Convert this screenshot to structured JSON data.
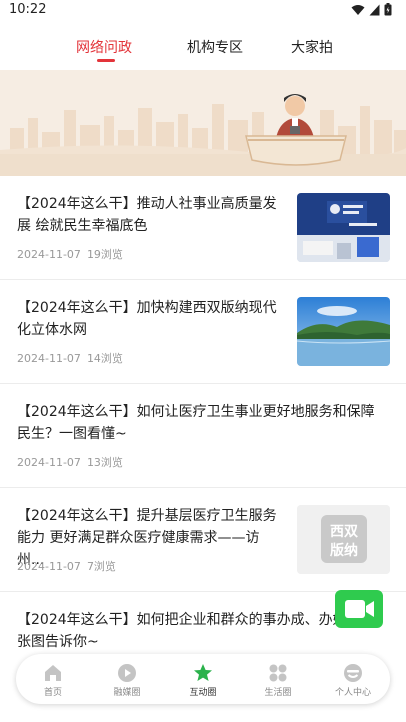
{
  "status_bar": {
    "time": "10:22"
  },
  "tabs": [
    {
      "label": "网络问政",
      "active": true
    },
    {
      "label": "机构专区",
      "active": false
    },
    {
      "label": "大家拍",
      "active": false
    }
  ],
  "articles": [
    {
      "title": "【2024年这么干】推动人社事业高质量发展 绘就民生幸福底色",
      "date": "2024-11-07",
      "views": "19浏览",
      "thumb": "hall-photo"
    },
    {
      "title": "【2024年这么干】加快构建西双版纳现代化立体水网",
      "date": "2024-11-07",
      "views": "14浏览",
      "thumb": "lake-photo"
    },
    {
      "title": "【2024年这么干】如何让医疗卫生事业更好地服务和保障民生？一图看懂~",
      "date": "2024-11-07",
      "views": "13浏览",
      "thumb": ""
    },
    {
      "title": "【2024年这么干】提升基层医疗卫生服务能力 更好满足群众医疗健康需求——访州...",
      "date": "2024-11-07",
      "views": "7浏览",
      "thumb": "xsbn-logo",
      "logo_text": [
        "西双",
        "版纳"
      ]
    },
    {
      "title": "【2024年这么干】如何把企业和群众的事办成、办好？一张图告诉你~",
      "date": "",
      "views": "",
      "thumb": ""
    }
  ],
  "bottom_nav": [
    {
      "label": "首页",
      "icon": "home-icon",
      "active": false
    },
    {
      "label": "融媒圈",
      "icon": "play-icon",
      "active": false
    },
    {
      "label": "互动圈",
      "icon": "star-icon",
      "active": true
    },
    {
      "label": "生活圈",
      "icon": "grid-icon",
      "active": false
    },
    {
      "label": "个人中心",
      "icon": "user-icon",
      "active": false
    }
  ],
  "colors": {
    "accent": "#e3343a",
    "active_nav": "#2bb24c",
    "float_button": "#2fcb4e"
  }
}
